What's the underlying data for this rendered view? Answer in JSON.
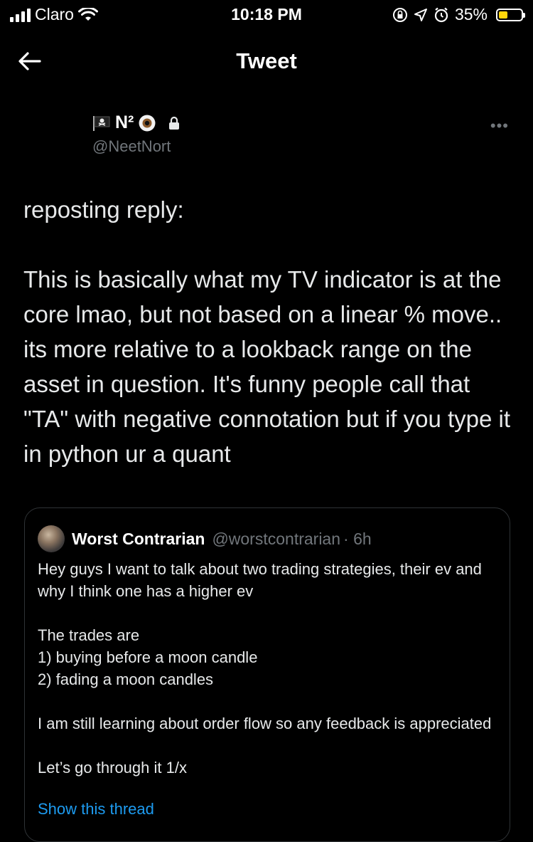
{
  "status_bar": {
    "carrier": "Claro",
    "time": "10:18 PM",
    "battery_percent": "35%",
    "battery_level": 0.35,
    "battery_color": "#ffd60a"
  },
  "nav": {
    "title": "Tweet",
    "back_icon": "arrow-left-icon"
  },
  "tweet": {
    "author_name": "N²",
    "author_handle": "@NeetNort",
    "protected": true,
    "more_label": "•••",
    "text": "reposting reply:\n\nThis is basically what my TV indicator is at the core lmao, but not based on a linear % move.. its more relative to a lookback range on the asset in question. It's funny people call that \"TA\" with negative connotation but if you type it in python ur a quant"
  },
  "quote": {
    "author_name": "Worst Contrarian",
    "author_handle": "@worstcontrarian",
    "time": "· 6h",
    "text": "Hey guys I want to talk about two trading strategies, their ev and why I think one has a higher ev\n\nThe trades are\n1) buying before a moon candle\n2) fading a moon candles\n\nI am still learning about order flow so any feedback is appreciated\n\nLet’s go through it 1/x",
    "show_thread": "Show this thread"
  },
  "colors": {
    "background": "#000000",
    "text": "#e7e9ea",
    "muted": "#71767b",
    "accent": "#1d9bf0"
  }
}
